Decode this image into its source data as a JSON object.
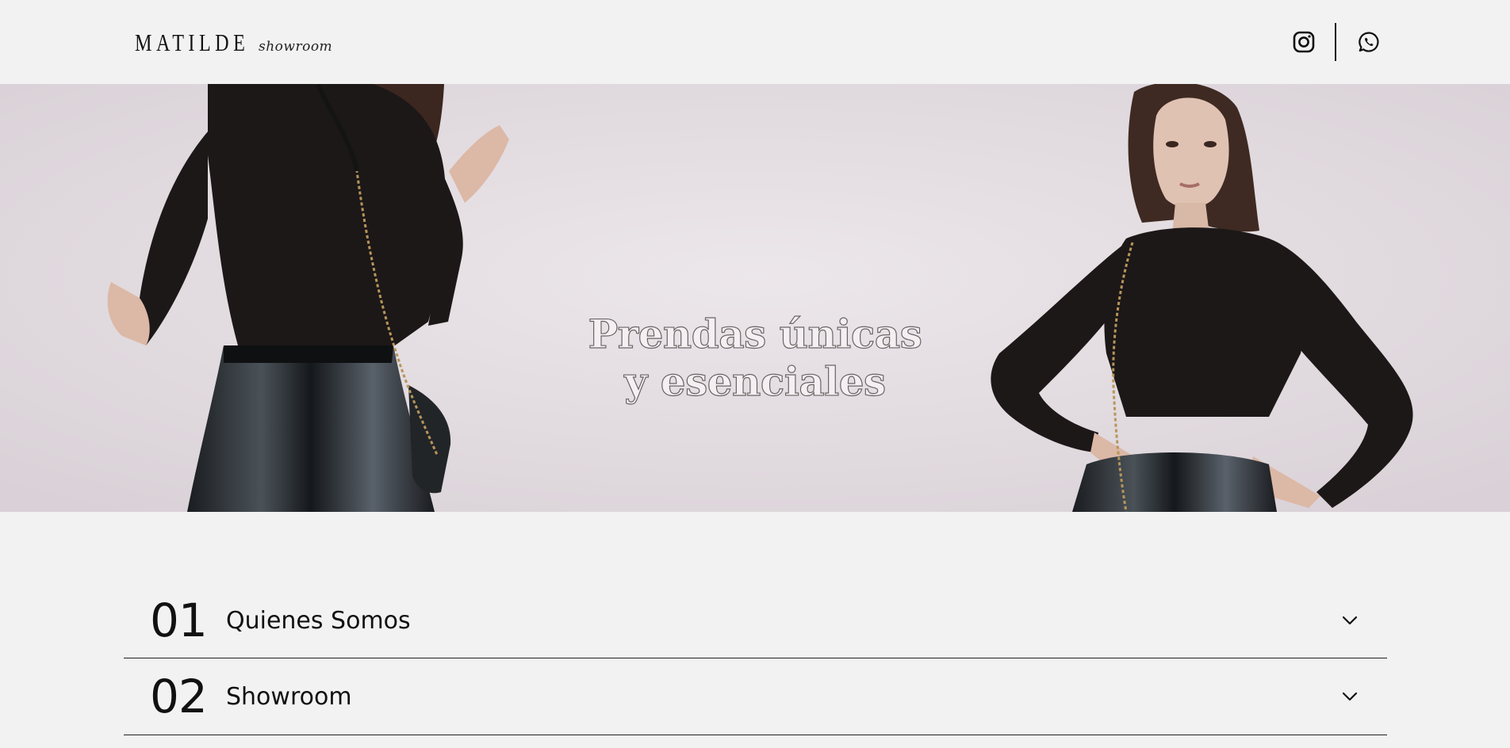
{
  "header": {
    "logo_main": "MATILDE",
    "logo_sub": "showroom",
    "icons": [
      "instagram-icon",
      "whatsapp-icon"
    ]
  },
  "hero": {
    "title_line1": "Prendas únicas",
    "title_line2": "y esenciales"
  },
  "accordion": [
    {
      "number": "01",
      "label": "Quienes Somos"
    },
    {
      "number": "02",
      "label": "Showroom"
    }
  ],
  "colors": {
    "background": "#f2f2f2",
    "text": "#111111",
    "hero_bg": "#e6e0e3",
    "garment": "#1c1818"
  }
}
